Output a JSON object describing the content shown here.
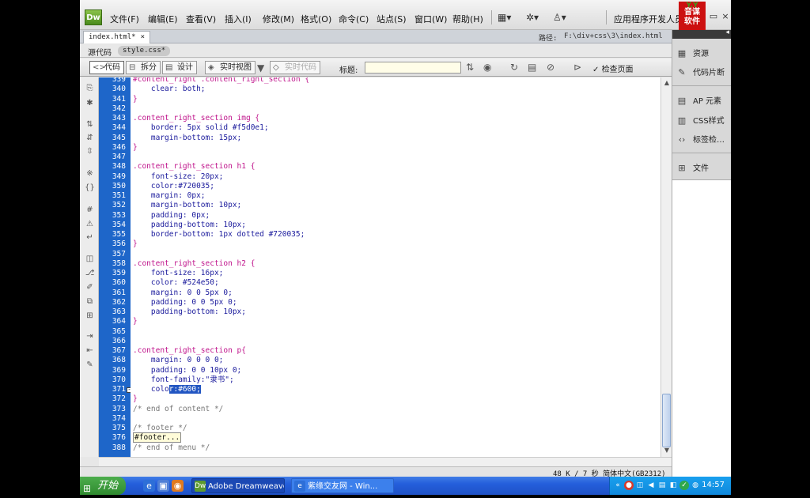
{
  "app": {
    "logo": "Dw",
    "menus": [
      "文件(F)",
      "编辑(E)",
      "查看(V)",
      "插入(I)",
      "修改(M)",
      "格式(O)",
      "命令(C)",
      "站点(S)",
      "窗口(W)",
      "帮助(H)"
    ],
    "workspace": "应用程序开发人员",
    "brand_top": "Y.Y",
    "brand_line1": "音谋",
    "brand_line2": "软件"
  },
  "tab": {
    "label": "index.html*",
    "close": "×",
    "path_label": "路径:",
    "path": "F:\\div+css\\3\\index.html"
  },
  "related": {
    "source_code": "源代码",
    "css_file": "style.css*"
  },
  "doc_toolbar": {
    "code": "代码",
    "split": "拆分",
    "design": "设计",
    "live_view": "实时视图",
    "live_code": "实时代码",
    "title_label": "标题:",
    "title_value": "",
    "check_page": "检查页面"
  },
  "editor": {
    "lines": [
      {
        "n": "339",
        "t": "#content_right .content_right_section {",
        "k": "sel"
      },
      {
        "n": "340",
        "t": "    clear: both;",
        "k": "prop"
      },
      {
        "n": "341",
        "t": "}",
        "k": "brc"
      },
      {
        "n": "342",
        "t": "",
        "k": "plain"
      },
      {
        "n": "343",
        "t": ".content_right_section img {",
        "k": "sel"
      },
      {
        "n": "344",
        "t": "    border: 5px solid #f5d0e1;",
        "k": "prop"
      },
      {
        "n": "345",
        "t": "    margin-bottom: 15px;",
        "k": "prop"
      },
      {
        "n": "346",
        "t": "}",
        "k": "brc"
      },
      {
        "n": "347",
        "t": "",
        "k": "plain"
      },
      {
        "n": "348",
        "t": ".content_right_section h1 {",
        "k": "sel"
      },
      {
        "n": "349",
        "t": "    font-size: 20px;",
        "k": "prop"
      },
      {
        "n": "350",
        "t": "    color:#720035;",
        "k": "prop"
      },
      {
        "n": "351",
        "t": "    margin: 0px;",
        "k": "prop"
      },
      {
        "n": "352",
        "t": "    margin-bottom: 10px;",
        "k": "prop"
      },
      {
        "n": "353",
        "t": "    padding: 0px;",
        "k": "prop"
      },
      {
        "n": "354",
        "t": "    padding-bottom: 10px;",
        "k": "prop"
      },
      {
        "n": "355",
        "t": "    border-bottom: 1px dotted #720035;",
        "k": "prop"
      },
      {
        "n": "356",
        "t": "}",
        "k": "brc"
      },
      {
        "n": "357",
        "t": "",
        "k": "plain"
      },
      {
        "n": "358",
        "t": ".content_right_section h2 {",
        "k": "sel"
      },
      {
        "n": "359",
        "t": "    font-size: 16px;",
        "k": "prop"
      },
      {
        "n": "360",
        "t": "    color: #524e50;",
        "k": "prop"
      },
      {
        "n": "361",
        "t": "    margin: 0 0 5px 0;",
        "k": "prop"
      },
      {
        "n": "362",
        "t": "    padding: 0 0 5px 0;",
        "k": "prop"
      },
      {
        "n": "363",
        "t": "    padding-bottom: 10px;",
        "k": "prop"
      },
      {
        "n": "364",
        "t": "}",
        "k": "brc"
      },
      {
        "n": "365",
        "t": "",
        "k": "plain"
      },
      {
        "n": "366",
        "t": "",
        "k": "plain"
      },
      {
        "n": "367",
        "t": ".content_right_section p{",
        "k": "sel"
      },
      {
        "n": "368",
        "t": "    margin: 0 0 0 0;",
        "k": "prop"
      },
      {
        "n": "369",
        "t": "    padding: 0 0 10px 0;",
        "k": "prop"
      },
      {
        "n": "370",
        "t": "    font-family:\"隶书\";",
        "k": "prop"
      },
      {
        "n": "371",
        "t": "    colo",
        "k": "cursor",
        "hl": "r:#600;"
      },
      {
        "n": "372",
        "t": "}",
        "k": "brc"
      },
      {
        "n": "373",
        "t": "/* end of content */",
        "k": "cmt"
      },
      {
        "n": "374",
        "t": "",
        "k": "plain"
      },
      {
        "n": "375",
        "t": "/* footer */",
        "k": "cmt"
      },
      {
        "n": "376",
        "t": "#footer...",
        "k": "boxed"
      },
      {
        "n": "388",
        "t": "/* end of menu */",
        "k": "cmt"
      }
    ]
  },
  "status": {
    "text": "48 K / 7 秒 简体中文(GB2312)"
  },
  "panel": {
    "items": [
      {
        "icon": "▦",
        "label": "资源"
      },
      {
        "icon": "✎",
        "label": "代码片断"
      },
      {
        "icon": "▤",
        "label": "AP 元素"
      },
      {
        "icon": "▥",
        "label": "CSS样式"
      },
      {
        "icon": "‹›",
        "label": "标签检…"
      },
      {
        "icon": "⊞",
        "label": "文件"
      }
    ]
  },
  "taskbar": {
    "start": "开始",
    "tasks": [
      "Adobe Dreamweave...",
      "紫缘交友网 - Win..."
    ],
    "clock": "14:57"
  },
  "colors": {
    "line_number_bg": "#1e66c9",
    "selector": "#c0158c",
    "property": "#1a1a9c",
    "selection": "#2155c2",
    "taskbar": "#245edb",
    "tray": "#0f88dc"
  }
}
